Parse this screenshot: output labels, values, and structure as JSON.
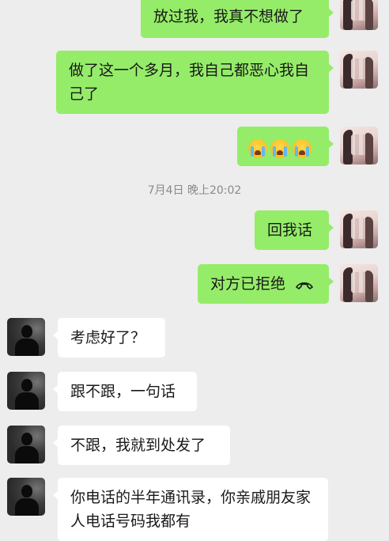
{
  "messages": [
    {
      "side": "sent",
      "text": "放过我，我真不想做了"
    },
    {
      "side": "sent",
      "text": "做了这一个多月，我自己都恶心我自己了"
    },
    {
      "side": "sent",
      "emoji": [
        "crying-face-emoji",
        "crying-face-emoji",
        "crying-face-emoji"
      ]
    },
    {
      "side": "timestamp",
      "text": "7月4日 晚上20:02"
    },
    {
      "side": "sent",
      "text": "回我话"
    },
    {
      "side": "sent",
      "text": "对方已拒绝",
      "icon": "phone-hangup-icon"
    },
    {
      "side": "recv",
      "text": "考虑好了？"
    },
    {
      "side": "recv",
      "text": "跟不跟，一句话"
    },
    {
      "side": "recv",
      "text": "不跟，我就到处发了"
    },
    {
      "side": "recv",
      "text": "你电话的半年通讯录，你亲戚朋友家人电话号码我都有"
    }
  ],
  "colors": {
    "sent_bubble": "#95ec69",
    "recv_bubble": "#ffffff",
    "background": "#ededed",
    "timestamp": "#8a8a8a"
  }
}
